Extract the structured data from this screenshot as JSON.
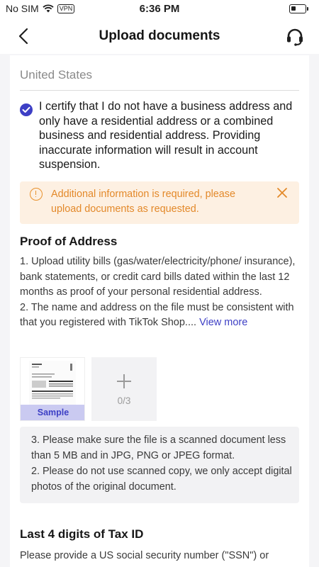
{
  "status_bar": {
    "carrier": "No SIM",
    "vpn": "VPN",
    "time": "6:36 PM"
  },
  "nav": {
    "title": "Upload documents"
  },
  "form": {
    "country_value": "United States",
    "certify_checked": true,
    "certify_text": "I certify that I do not have a business address and only have a residential address or a combined business and residential address. Providing inaccurate information will result in account suspension."
  },
  "warning": {
    "text": "Additional information is required, please upload documents as requested."
  },
  "proof_of_address": {
    "title": "Proof of Address",
    "line1": "1. Upload utility bills (gas/water/electricity/phone/ insurance), bank statements, or credit card bills dated within the last 12 months as proof of your personal residential address.",
    "line2": "2. The name and address on the file must be consistent with that you registered with TikTok Shop....",
    "view_more": "View more",
    "sample_label": "Sample",
    "upload_count": "0/3",
    "note1": "3. Please make sure the file is a scanned document less than 5 MB and in JPG, PNG or JPEG format.",
    "note2": "2. Please do not use scanned copy, we only accept digital photos of the original document."
  },
  "tax_id": {
    "title": "Last 4 digits of Tax ID",
    "desc": "Please provide a US social security number (\"SSN\") or"
  },
  "colors": {
    "accent": "#3d3fc5",
    "warning_text": "#e3892a",
    "warning_bg": "#fdf0e2"
  }
}
